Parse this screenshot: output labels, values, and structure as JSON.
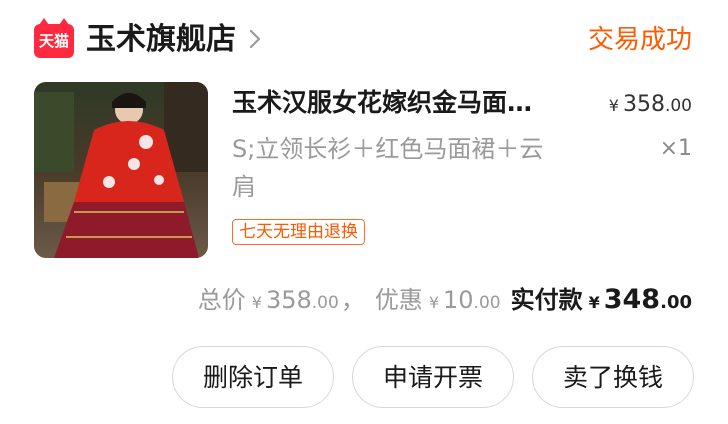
{
  "shop": {
    "logo_text": "天猫",
    "name": "玉术旗舰店",
    "status": "交易成功"
  },
  "product": {
    "title": "玉术汉服女花嫁织金马面…",
    "spec": "S;立领长衫＋红色马面裙＋云肩",
    "price_currency": "¥",
    "price_int": "358",
    "price_dec": ".00",
    "quantity": "×1",
    "return_badge": "七天无理由退换"
  },
  "totals": {
    "total_label": "总价",
    "total_currency": "¥",
    "total_int": "358",
    "total_dec": ".00",
    "separator": "，",
    "discount_label": "优惠",
    "discount_currency": "¥",
    "discount_int": "10",
    "discount_dec": ".00",
    "paid_label": "实付款",
    "paid_currency": "¥",
    "paid_int": "348",
    "paid_dec": ".00"
  },
  "actions": {
    "delete_label": "删除订单",
    "invoice_label": "申请开票",
    "resell_label": "卖了换钱"
  },
  "colors": {
    "status_orange": "#ff5a00",
    "tmall_red": "#ff2a3f"
  }
}
